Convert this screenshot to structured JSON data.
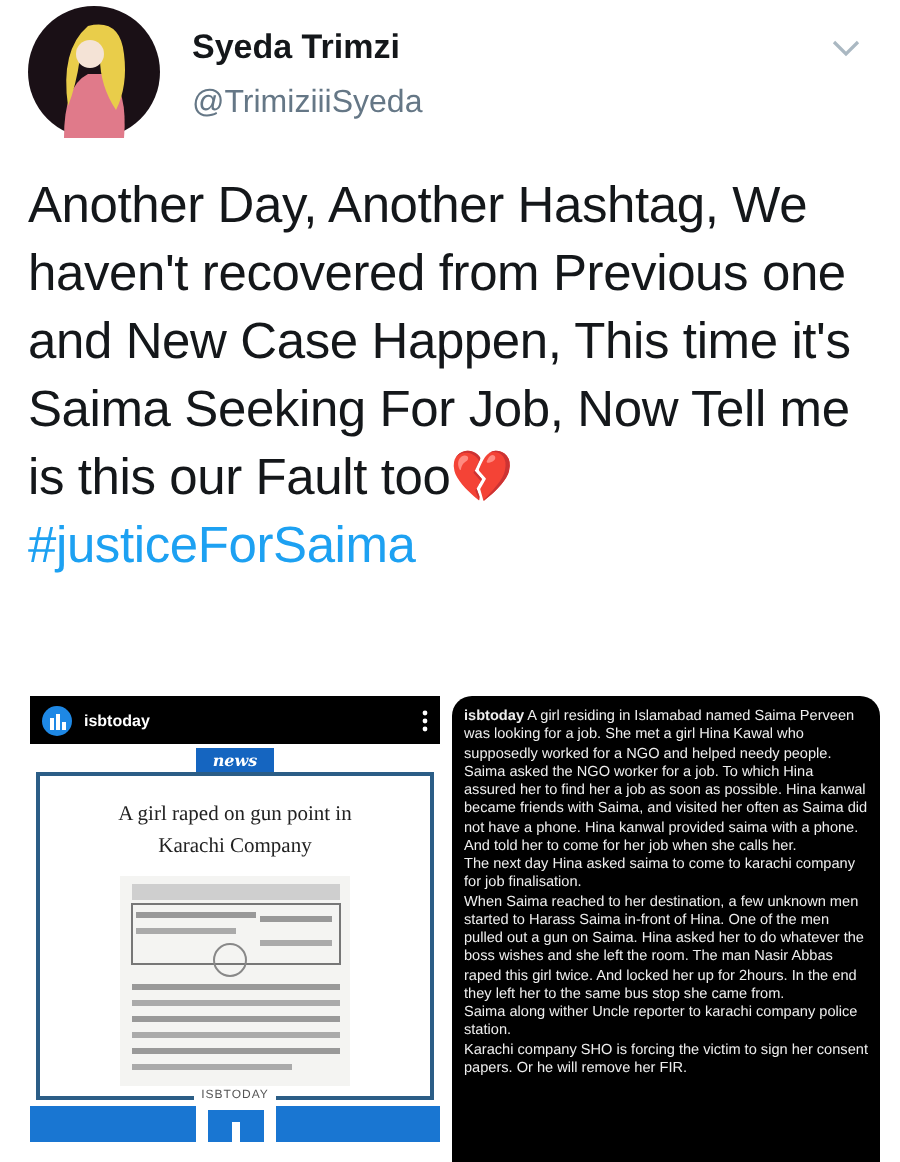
{
  "author": {
    "name": "Syeda Trimzi",
    "handle": "@TrimiziiiSyeda"
  },
  "tweet": {
    "text": "Another Day, Another Hashtag, We haven't recovered from Previous one and New Case Happen, This time it's Saima Seeking For Job, Now Tell me is this our Fault too💔",
    "hashtag": "#justiceForSaima"
  },
  "media": [
    {
      "kind": "post",
      "account": "isbtoday",
      "tag": "news",
      "headline": "A girl raped on gun point in Karachi Company",
      "footer": "ISBTODAY"
    },
    {
      "kind": "caption",
      "paragraphs": [
        "**isbtoday** A girl residing in Islamabad named Saima Perveen was looking for a job. She met a girl Hina Kawal who supposedly worked for a NGO and helped needy people. Saima asked the NGO worker for a job. To which Hina assured her to find her a job as soon as possible. Hina kanwal became friends with Saima, and visited her often as Saima did not have a phone. Hina kanwal provided saima with a phone. And told her to come for her job when she calls her.",
        "The next day Hina asked saima to come to karachi company for job finalisation.",
        "When Saima reached to her destination, a few unknown men started to Harass Saima in-front of Hina. One of the men pulled out a gun on Saima. Hina asked her to do whatever the boss wishes and she left the room. The man Nasir Abbas raped this girl twice. And locked her up for 2hours. In the end they left her to the same bus stop she came from.",
        "Saima along wither Uncle reporter to karachi company police station.",
        "Karachi company SHO is forcing the victim to sign her consent papers. Or he will remove her FIR."
      ]
    }
  ]
}
